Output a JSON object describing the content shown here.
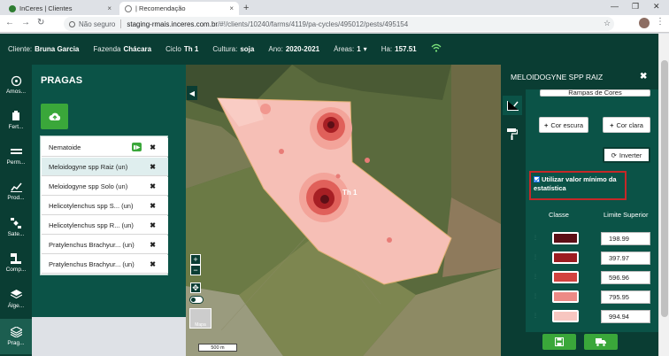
{
  "browser": {
    "tabs": [
      {
        "title": "InCeres | Clientes"
      },
      {
        "title": "| Recomendação"
      }
    ],
    "security_label": "Não seguro",
    "url_host": "staging-rmais.inceres.com.br",
    "url_path": "/#!/clients/10240/farms/4119/pa-cycles/495012/pests/495154"
  },
  "header": {
    "client_label": "Cliente:",
    "client_value": "Bruna Garcia",
    "farm_label": "Fazenda",
    "farm_value": "Chácara",
    "cycle_label": "Ciclo",
    "cycle_value": "Th 1",
    "crop_label": "Cultura:",
    "crop_value": "soja",
    "year_label": "Ano:",
    "year_value": "2020-2021",
    "areas_label": "Áreas:",
    "areas_value": "1",
    "ha_label": "Ha:",
    "ha_value": "157.51"
  },
  "iconbar": [
    {
      "label": "Amos...",
      "icon": "sampling-icon"
    },
    {
      "label": "Fert...",
      "icon": "fertilizer-icon"
    },
    {
      "label": "Perm...",
      "icon": "soil-icon"
    },
    {
      "label": "Prod...",
      "icon": "chart-icon"
    },
    {
      "label": "Sate...",
      "icon": "satellite-icon"
    },
    {
      "label": "Comp...",
      "icon": "compaction-icon"
    },
    {
      "label": "Álge...",
      "icon": "layers-icon"
    },
    {
      "label": "Prag...",
      "icon": "pests-icon"
    }
  ],
  "pragas": {
    "title": "PRAGAS",
    "items": [
      {
        "label": "Nematoide"
      },
      {
        "label": "Meloidogyne spp Raiz (un)"
      },
      {
        "label": "Meloidogyne spp Solo (un)"
      },
      {
        "label": "Helicotylenchus spp S... (un)"
      },
      {
        "label": "Helicotylenchus spp R... (un)"
      },
      {
        "label": "Pratylenchus Brachyur... (un)"
      },
      {
        "label": "Pratylenchus Brachyur... (un)"
      }
    ],
    "close_glyph": "✖"
  },
  "map": {
    "field_label": "Th 1",
    "scale_label": "500 m",
    "zoom_in": "+",
    "zoom_out": "−",
    "thumb_label": "Mapa"
  },
  "panel": {
    "title": "MELOIDOGYNE SPP RAIZ",
    "ramp_label": "Rampas de Cores",
    "dark_label": "Cor escura",
    "light_label": "Cor clara",
    "invert_label": "Inverter",
    "min_label": "Utilizar valor mínimo da estatística",
    "col_class": "Classe",
    "col_limit": "Limite Superior",
    "classes": [
      {
        "color": "#5c0f16",
        "limit": "198.99"
      },
      {
        "color": "#9c1c20",
        "limit": "397.97"
      },
      {
        "color": "#d2423f",
        "limit": "596.96"
      },
      {
        "color": "#ed8a86",
        "limit": "795.95"
      },
      {
        "color": "#f7c6c0",
        "limit": "994.94"
      }
    ]
  }
}
